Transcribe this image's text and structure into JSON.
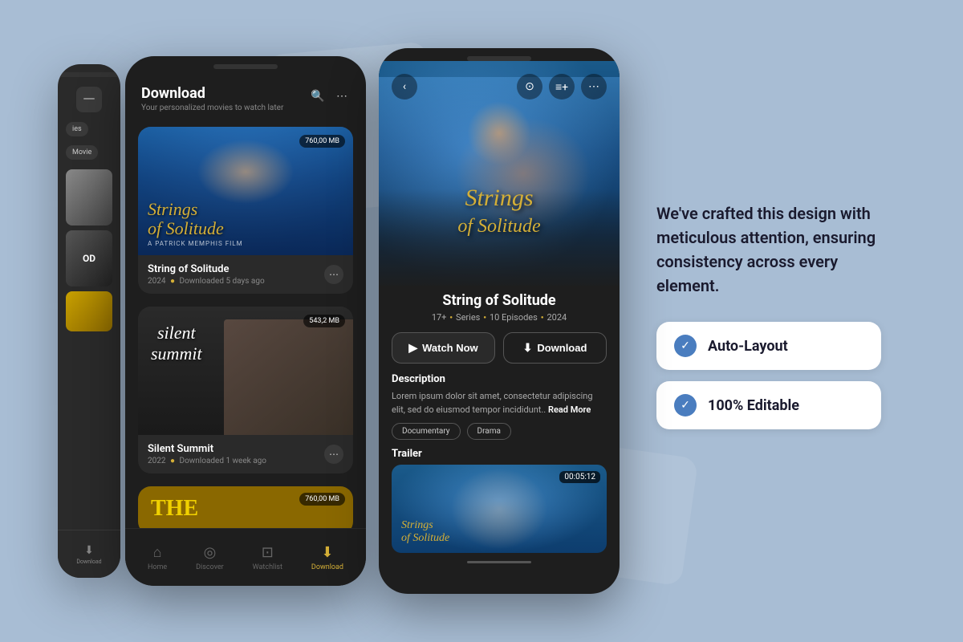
{
  "background": {
    "color": "#a8bdd4"
  },
  "phone_left": {
    "visible": true,
    "chips": [
      "ies",
      "Movie"
    ]
  },
  "phone_middle": {
    "title": "Download",
    "subtitle": "Your personalized movies to watch later",
    "movies": [
      {
        "title": "String of Solitude",
        "year": "2024",
        "downloaded": "Downloaded 5 days ago",
        "file_size": "760,00 MB",
        "poster_style": "water"
      },
      {
        "title": "Silent Summit",
        "year": "2022",
        "downloaded": "Downloaded 1 week ago",
        "file_size": "543,2 MB",
        "poster_style": "dark"
      }
    ],
    "nav": [
      {
        "label": "Home",
        "icon": "⌂",
        "active": false
      },
      {
        "label": "Discover",
        "icon": "◎",
        "active": false
      },
      {
        "label": "Watchlist",
        "icon": "⊡",
        "active": false
      },
      {
        "label": "Download",
        "icon": "⬇",
        "active": true
      }
    ]
  },
  "phone_right": {
    "movie_title": "String of Solitude",
    "meta": {
      "rating": "17+",
      "type": "Series",
      "episodes": "10 Episodes",
      "year": "2024"
    },
    "buttons": {
      "watch": "Watch Now",
      "download": "Download"
    },
    "description": {
      "label": "Description",
      "text": "Lorem ipsum dolor sit amet, consectetur adipiscing elit, sed do eiusmod tempor incididunt..",
      "read_more": "Read More"
    },
    "tags": [
      "Documentary",
      "Drama"
    ],
    "trailer": {
      "label": "Trailer",
      "duration": "00:05:12"
    }
  },
  "info_panel": {
    "text": "We've crafted this design with meticulous attention, ensuring consistency across every element.",
    "features": [
      {
        "label": "Auto-Layout",
        "check": "✓"
      },
      {
        "label": "100% Editable",
        "check": "✓"
      }
    ]
  }
}
